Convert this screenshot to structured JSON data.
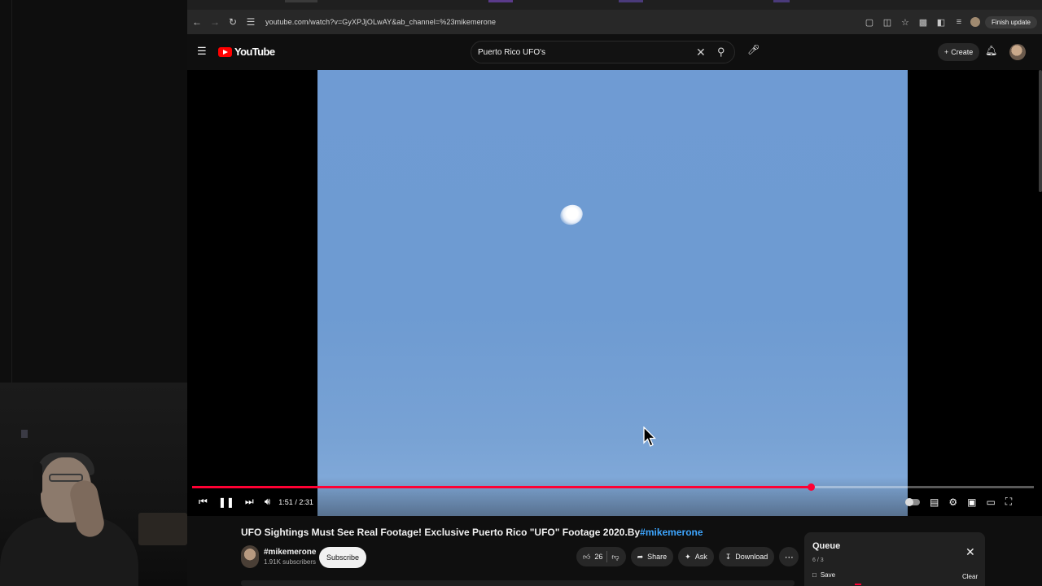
{
  "browser": {
    "url": "youtube.com/watch?v=GyXPJjOLwAY&ab_channel=%23mikemerone",
    "finish_update_label": "Finish update"
  },
  "youtube": {
    "logo_text": "YouTube",
    "search_value": "Puerto Rico UFO's",
    "create_label": "Create"
  },
  "player": {
    "time_display": "1:51 / 2:31",
    "progress_fraction": 0.735,
    "accent_color": "#ff0033"
  },
  "video": {
    "title_main": "UFO Sightings Must See Real Footage! Exclusive Puerto Rico \"UFO\" Footage 2020.By",
    "title_hashtag": "#mikemerone",
    "channel_name": "#mikemerone",
    "channel_subscribers": "1.91K subscribers",
    "subscribe_label": "Subscribe",
    "like_count": "26",
    "share_label": "Share",
    "ask_label": "Ask",
    "download_label": "Download"
  },
  "queue": {
    "title": "Queue",
    "count": "6 / 3",
    "save_label": "Save",
    "clear_label": "Clear"
  },
  "icons": [
    "back-icon",
    "forward-icon",
    "reload-icon",
    "site-info-icon",
    "install-icon",
    "translate-icon",
    "star-icon",
    "extensions-icon",
    "sidepanel-icon",
    "menu-icon",
    "search-icon",
    "clear-search-icon",
    "mic-icon",
    "plus-icon",
    "bell-icon",
    "prev-icon",
    "pause-icon",
    "next-icon",
    "volume-icon",
    "captions-icon",
    "settings-icon",
    "miniplayer-icon",
    "theater-icon",
    "fullscreen-icon",
    "like-icon",
    "dislike-icon",
    "share-icon",
    "ask-icon",
    "download-icon",
    "more-icon",
    "close-icon",
    "bookmark-icon"
  ]
}
